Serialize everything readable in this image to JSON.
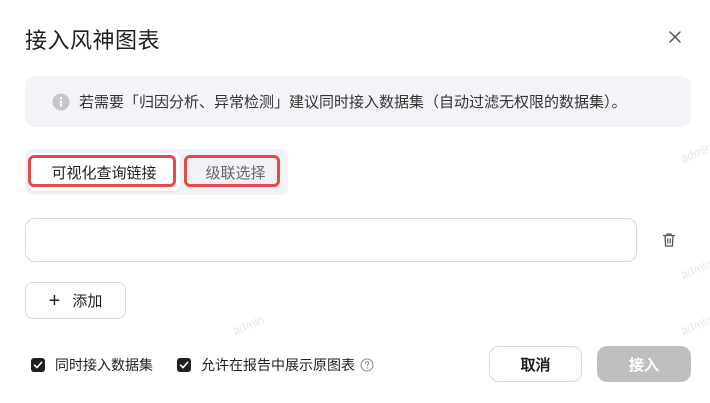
{
  "dialog": {
    "title": "接入风神图表",
    "notice": "若需要「归因分析、异常检测」建议同时接入数据集（自动过滤无权限的数据集）。",
    "tabs": [
      {
        "label": "可视化查询链接",
        "active": true
      },
      {
        "label": "级联选择",
        "active": false
      }
    ],
    "link_input": {
      "value": "",
      "placeholder": ""
    },
    "add_label": "添加",
    "options": [
      {
        "label": "同时接入数据集",
        "checked": true
      },
      {
        "label": "允许在报告中展示原图表",
        "checked": true
      }
    ],
    "cancel_label": "取消",
    "confirm_label": "接入",
    "watermark": "admin"
  },
  "colors": {
    "highlight": "#e84848",
    "confirm_disabled": "#bfbfbf",
    "notice_bg": "#f3f4f7"
  },
  "icons": [
    "close-icon",
    "info-icon",
    "trash-icon",
    "plus-icon",
    "checkmark-icon",
    "help-icon"
  ]
}
